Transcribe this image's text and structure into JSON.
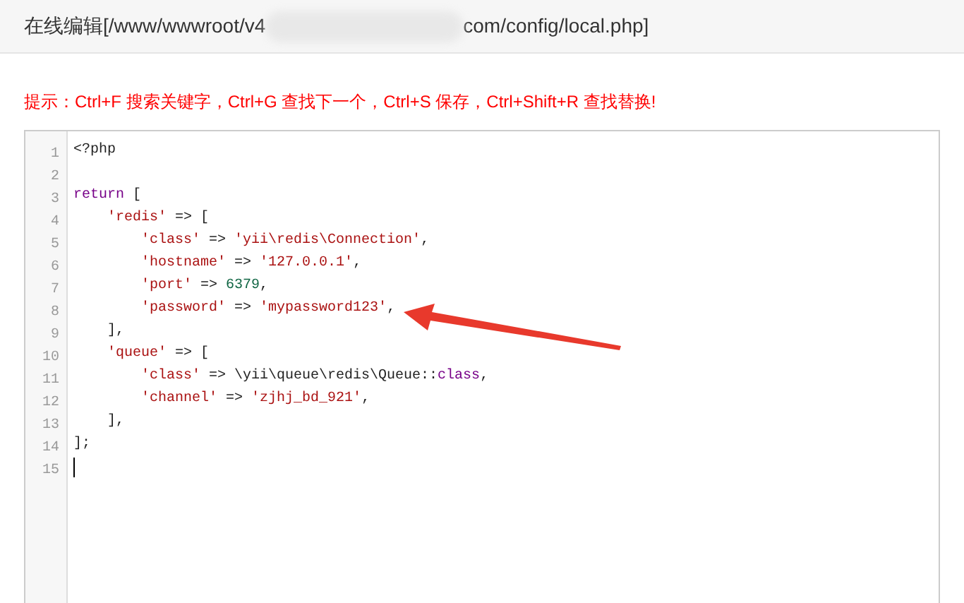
{
  "window": {
    "title_start": "在线编辑[/www/wwwroot/v4",
    "title_end": "com/config/local.php]"
  },
  "hint": "提示：Ctrl+F 搜索关键字，Ctrl+G 查找下一个，Ctrl+S 保存，Ctrl+Shift+R 查找替换!",
  "editor": {
    "lines": [
      {
        "number": "1",
        "cursor": false,
        "tokens": [
          {
            "kind": "plain",
            "text": "<?php"
          }
        ]
      },
      {
        "number": "2",
        "cursor": false
      },
      {
        "number": "3",
        "cursor": false,
        "tokens": [
          {
            "kind": "keyword",
            "text": "return"
          },
          {
            "kind": "plain",
            "text": " ["
          }
        ]
      },
      {
        "number": "4",
        "cursor": false,
        "tokens": [
          {
            "kind": "string",
            "text": "    'redis'"
          },
          {
            "kind": "plain",
            "text": " => ["
          }
        ]
      },
      {
        "number": "5",
        "cursor": false,
        "tokens": [
          {
            "kind": "string",
            "text": "        'class'"
          },
          {
            "kind": "plain",
            "text": " => "
          },
          {
            "kind": "string",
            "text": "'yii\\redis\\Connection'"
          },
          {
            "kind": "plain",
            "text": ","
          }
        ]
      },
      {
        "number": "6",
        "cursor": false,
        "tokens": [
          {
            "kind": "string",
            "text": "        'hostname'"
          },
          {
            "kind": "plain",
            "text": " => "
          },
          {
            "kind": "string",
            "text": "'127.0.0.1'"
          },
          {
            "kind": "plain",
            "text": ","
          }
        ]
      },
      {
        "number": "7",
        "cursor": false,
        "tokens": [
          {
            "kind": "string",
            "text": "        'port'"
          },
          {
            "kind": "plain",
            "text": " => "
          },
          {
            "kind": "number",
            "text": "6379"
          },
          {
            "kind": "plain",
            "text": ","
          }
        ]
      },
      {
        "number": "8",
        "cursor": false,
        "tokens": [
          {
            "kind": "string",
            "text": "        'password'"
          },
          {
            "kind": "plain",
            "text": " => "
          },
          {
            "kind": "string",
            "text": "'mypassword123'"
          },
          {
            "kind": "plain",
            "text": ","
          }
        ]
      },
      {
        "number": "9",
        "cursor": false,
        "tokens": [
          {
            "kind": "plain",
            "text": "    ],"
          }
        ]
      },
      {
        "number": "10",
        "cursor": false,
        "tokens": [
          {
            "kind": "string",
            "text": "    'queue'"
          },
          {
            "kind": "plain",
            "text": " => ["
          }
        ]
      },
      {
        "number": "11",
        "cursor": false,
        "tokens": [
          {
            "kind": "string",
            "text": "        'class'"
          },
          {
            "kind": "plain",
            "text": " => \\yii\\queue\\redis\\Queue::"
          },
          {
            "kind": "keyword",
            "text": "class"
          },
          {
            "kind": "plain",
            "text": ","
          }
        ]
      },
      {
        "number": "12",
        "cursor": false,
        "tokens": [
          {
            "kind": "string",
            "text": "        'channel'"
          },
          {
            "kind": "plain",
            "text": " => "
          },
          {
            "kind": "string",
            "text": "'zjhj_bd_921'"
          },
          {
            "kind": "plain",
            "text": ","
          }
        ]
      },
      {
        "number": "13",
        "cursor": false,
        "tokens": [
          {
            "kind": "plain",
            "text": "    ],"
          }
        ]
      },
      {
        "number": "14",
        "cursor": false,
        "tokens": [
          {
            "kind": "plain",
            "text": "];"
          }
        ]
      },
      {
        "number": "15",
        "cursor": true
      }
    ]
  }
}
